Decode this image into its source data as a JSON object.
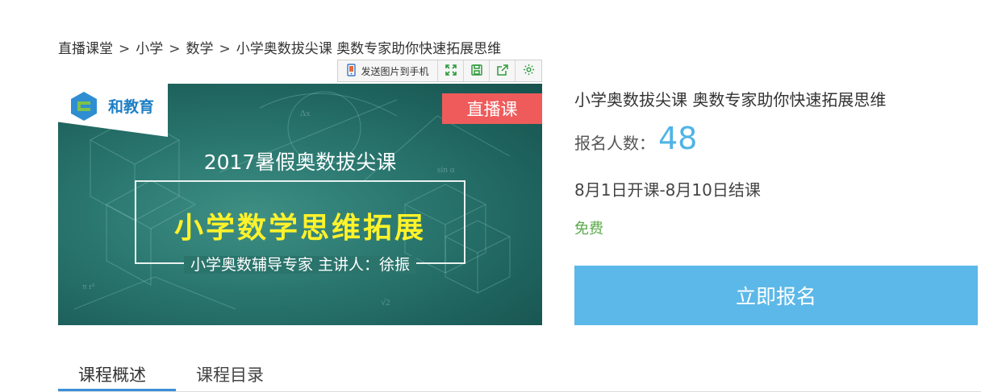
{
  "breadcrumb": {
    "items": [
      "直播课堂",
      "小学",
      "数学",
      "小学奥数拔尖课 奥数专家助你快速拓展思维"
    ],
    "separator": ">"
  },
  "image_toolbar": {
    "send_label": "发送图片到手机",
    "icons": [
      "phone-icon",
      "expand-icon",
      "save-icon",
      "share-icon",
      "settings-icon"
    ]
  },
  "banner": {
    "logo_text": "和教育",
    "live_tag": "直播课",
    "subtitle_top": "2017暑假奥数拔尖课",
    "main_title": "小学数学思维拓展",
    "subtitle_bottom": "小学奥数辅导专家 主讲人：徐振"
  },
  "course": {
    "title": "小学奥数拔尖课 奥数专家助你快速拓展思维",
    "enroll_label": "报名人数：",
    "enroll_count": "48",
    "schedule": "8月1日开课-8月10日结课",
    "price": "免费",
    "enroll_button": "立即报名"
  },
  "tabs": [
    {
      "label": "课程概述",
      "active": true
    },
    {
      "label": "课程目录",
      "active": false
    }
  ],
  "colors": {
    "accent_blue": "#5cb8e8",
    "count_blue": "#4fb4e6",
    "free_green": "#5aaa4a",
    "live_red": "#ef5b5b",
    "title_yellow": "#fff22a",
    "tab_underline": "#3a8fd8"
  }
}
